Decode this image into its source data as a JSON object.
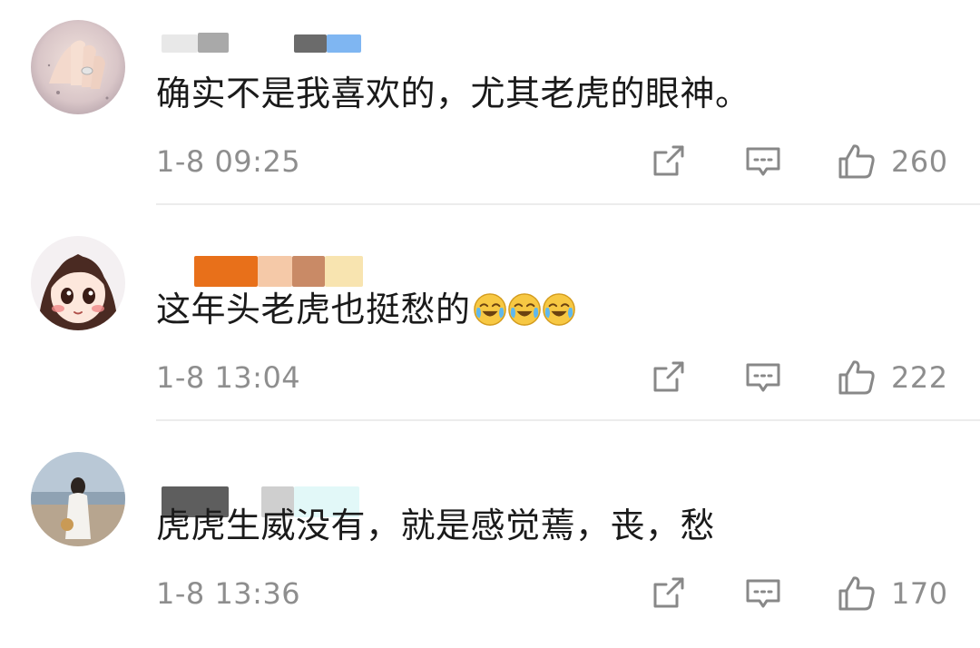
{
  "comments": [
    {
      "avatar_icon": "hand-ring-avatar",
      "username_colors": [
        "#e8e8e8",
        "#a9a9a9",
        "#6b6b6b",
        "#7fb6f2"
      ],
      "text": "确实不是我喜欢的，尤其老虎的眼神。",
      "time": "1-8 09:25",
      "likes": "260"
    },
    {
      "avatar_icon": "cartoon-girl-avatar",
      "username_colors": [
        "#e8701a",
        "#f5c9a8",
        "#c98a66",
        "#f8e4b0"
      ],
      "text": "这年头老虎也挺愁的",
      "emoji_count": 3,
      "time": "1-8 13:04",
      "likes": "222"
    },
    {
      "avatar_icon": "beach-photo-avatar",
      "username_colors": [
        "#5e5e5e",
        "#cfcfcf",
        "#e2f8f8"
      ],
      "text": "虎虎生威没有，就是感觉蔫，丧，愁",
      "time": "1-8 13:36",
      "likes": "170"
    }
  ],
  "icons": {
    "share": "share-icon",
    "reply": "comment-icon",
    "like": "thumbs-up-icon",
    "emoji": "cry-laugh-emoji"
  },
  "colors": {
    "meta_text": "#8e8e8e",
    "body_text": "#1a1a1a",
    "icon": "#888888",
    "divider": "#ececec"
  }
}
